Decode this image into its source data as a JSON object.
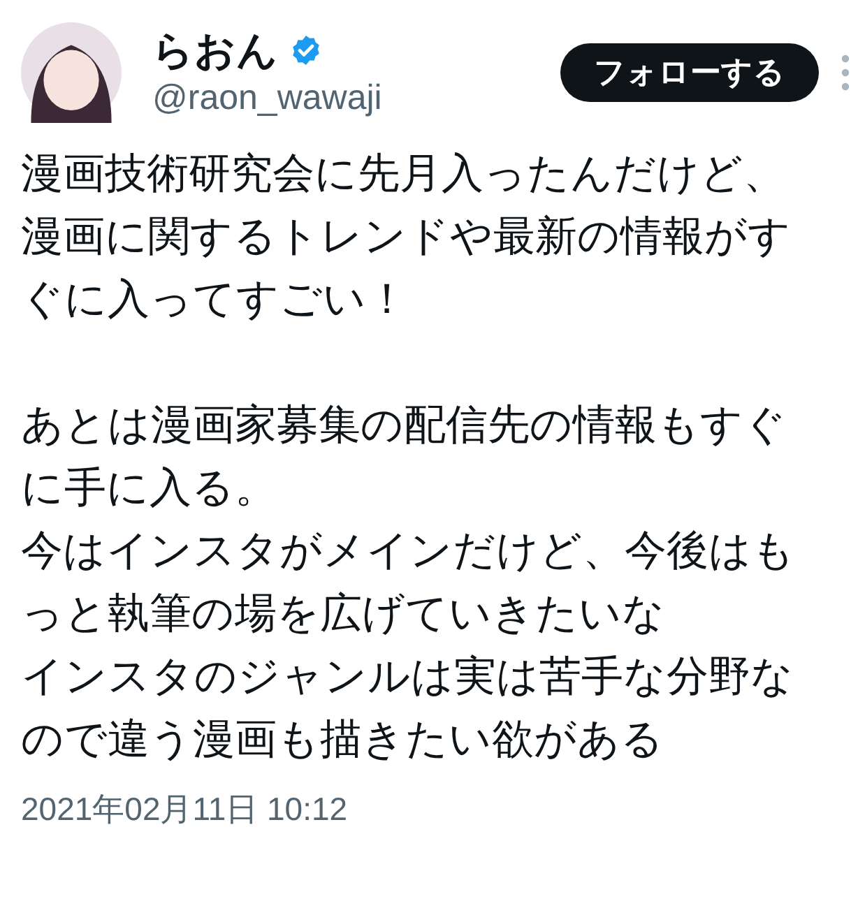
{
  "author": {
    "name": "らおん",
    "verified": true,
    "handle": "@raon_wawaji"
  },
  "follow_button": {
    "label": "フォローする"
  },
  "body": [
    [
      "漫画技術研究会に先月入ったんだけど、",
      "漫画に関するトレンドや最新の情報がす",
      "ぐに入ってすごい！"
    ],
    [
      "あとは漫画家募集の配信先の情報もすぐ",
      "に手に入る。",
      "今はインスタがメインだけど、今後はも",
      "っと執筆の場を広げていきたいな",
      "インスタのジャンルは実は苦手な分野な",
      "ので違う漫画も描きたい欲がある"
    ]
  ],
  "timestamp": "2021年02月11日 10:12"
}
